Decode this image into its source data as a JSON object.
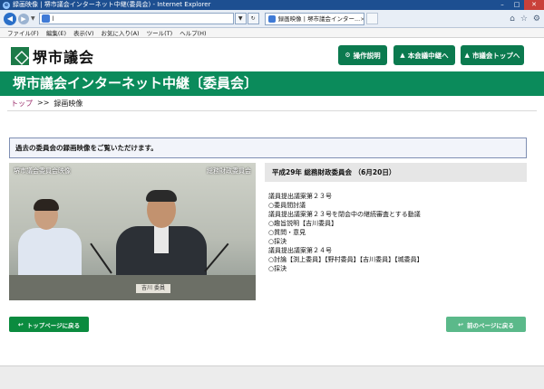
{
  "browser": {
    "window_title": "録画映像 | 堺市議会インターネット中継(委員会) - Internet Explorer",
    "address_text": "l",
    "tab_title": "録画映像 | 堺市議会インター...",
    "menu": [
      "ファイル(F)",
      "編集(E)",
      "表示(V)",
      "お気に入り(A)",
      "ツール(T)",
      "ヘルプ(H)"
    ]
  },
  "header": {
    "site_name": "堺市議会",
    "buttons": [
      {
        "label": "操作説明",
        "icon": "gear-icon"
      },
      {
        "label": "本会議中継へ",
        "icon": "building-icon"
      },
      {
        "label": "市議会トップへ",
        "icon": "building-icon"
      }
    ]
  },
  "page_title": "堺市議会インターネット中継〔委員会〕",
  "breadcrumb": {
    "home": "トップ",
    "separator": ">>",
    "current": "録画映像"
  },
  "notice": "過去の委員会の録画映像をご覧いただけます。",
  "video": {
    "caption_left": "堺市議会委員会映像",
    "caption_right": "総務財政委員会",
    "nameplate": "吉川 委員"
  },
  "agenda": {
    "heading": "平成29年 総務財政委員会 （6月20日）",
    "lines": [
      "議員提出議案第２３号",
      "○委員間討議",
      "議員提出議案第２３号を閉会中の継続審査とする動議",
      "○趣旨説明【吉川委員】",
      "○質問・意見",
      "○採決",
      "議員提出議案第２４号",
      "○討論【渕上委員】【野村委員】【吉川委員】【城委員】",
      "○採決"
    ]
  },
  "buttons": {
    "top": "トップページに戻る",
    "back": "前のページに戻る"
  },
  "colors": {
    "brand_green": "#0b8b5b",
    "button_green": "#0b8b3f",
    "button_green_light": "#5bb98a",
    "breadcrumb_link": "#9b2b6a"
  }
}
